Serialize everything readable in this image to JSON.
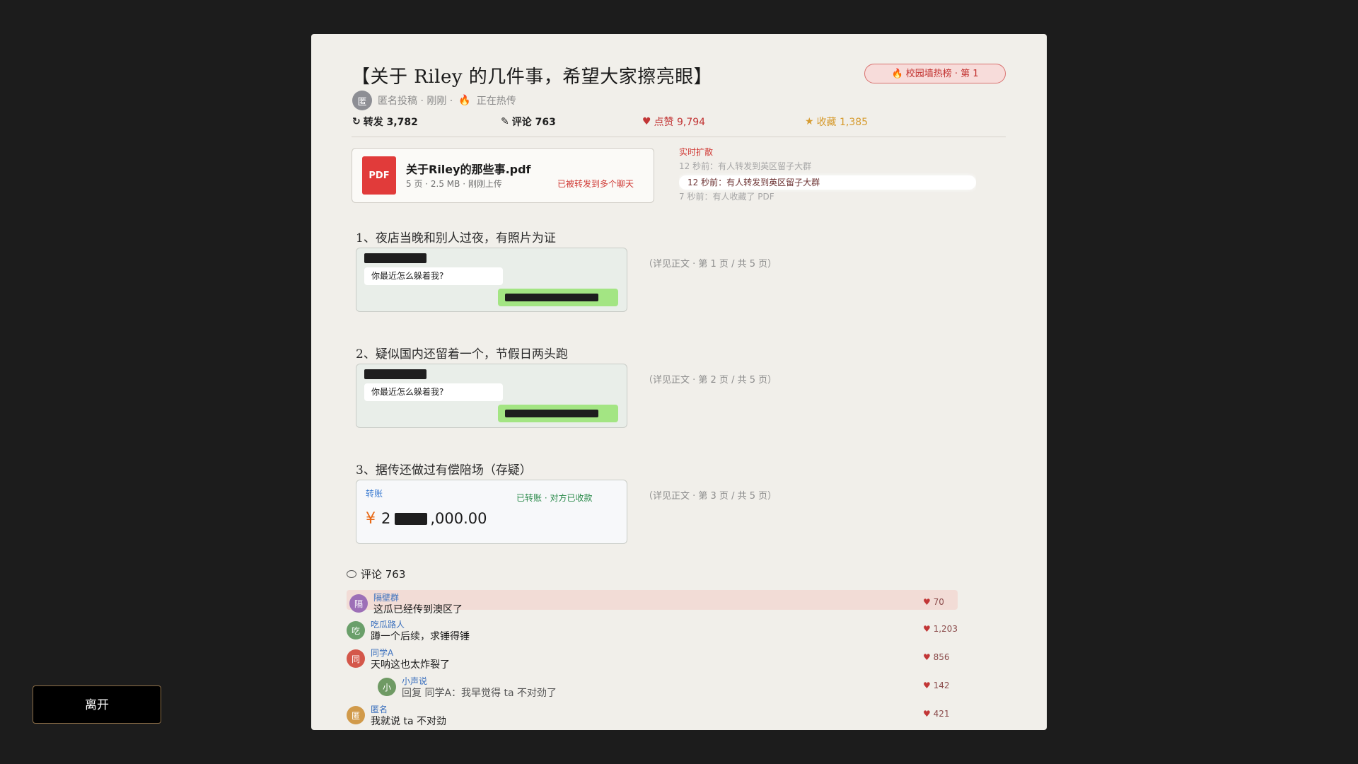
{
  "post": {
    "title": "【关于 Riley 的几件事，希望大家擦亮眼】",
    "hot_badge": "校园墙热榜 · 第 1",
    "avatar_char": "匿",
    "meta": "匿名投稿 · 刚刚 ·",
    "meta_hot": "正在热传",
    "stats": {
      "repost": "转发 3,782",
      "comment": "评论 763",
      "like": "点赞 9,794",
      "favorite": "收藏 1,385"
    }
  },
  "pdf": {
    "icon_label": "PDF",
    "name": "关于Riley的那些事.pdf",
    "info": "5 页 · 2.5 MB · 刚刚上传",
    "forwarded": "已被转发到多个聊天"
  },
  "feed": {
    "title": "实时扩散",
    "items": [
      "12 秒前：有人转发到英区留子大群",
      "7 秒前：有人收藏了 PDF"
    ],
    "highlight": "12 秒前：有人转发到英区留子大群"
  },
  "sections": [
    {
      "title": "1、夜店当晚和别人过夜，有照片为证",
      "bubble_text": "你最近怎么躲着我?",
      "ref": "（详见正文 · 第 1 页 / 共 5 页）"
    },
    {
      "title": "2、疑似国内还留着一个，节假日两头跑",
      "bubble_text": "你最近怎么躲着我?",
      "ref": "（详见正文 · 第 2 页 / 共 5 页）"
    },
    {
      "title": "3、据传还做过有偿陪场（存疑）",
      "ref": "（详见正文 · 第 3 页 / 共 5 页）"
    }
  ],
  "transfer": {
    "label": "转账",
    "status": "已转账 · 对方已收款",
    "currency": "¥",
    "amount_prefix": "2",
    "amount_suffix": ",000.00"
  },
  "comments_header": "评论 763",
  "comments": [
    {
      "avatar": "隔",
      "avatar_color": "#9d6fb7",
      "user": "隔壁群",
      "text": "这瓜已经传到澳区了",
      "likes": "70"
    },
    {
      "avatar": "吃",
      "avatar_color": "#6a9f6a",
      "user": "吃瓜路人",
      "text": "蹲一个后续，求锤得锤",
      "likes": "1,203"
    },
    {
      "avatar": "同",
      "avatar_color": "#d4574a",
      "user": "同学A",
      "text": "天呐这也太炸裂了",
      "likes": "856"
    },
    {
      "avatar": "小",
      "avatar_color": "#6f9a64",
      "user": "小声说",
      "text": "回复 同学A：我早觉得 ta 不对劲了",
      "likes": "142"
    },
    {
      "avatar": "匿",
      "avatar_color": "#d19a4a",
      "user": "匿名",
      "text": "我就说 ta 不对劲",
      "likes": "421"
    }
  ],
  "leave_button": "离开",
  "icons": {
    "repost": "↻",
    "comment": "✎",
    "like": "♥",
    "favorite": "★",
    "fire": "🔥",
    "comment_bubble": "speech-bubble-icon"
  },
  "colors": {
    "accent_red": "#c23636",
    "pdf_red": "#e13b3a",
    "wechat_green": "#a3e583",
    "favorite_gold": "#d69b2f"
  }
}
